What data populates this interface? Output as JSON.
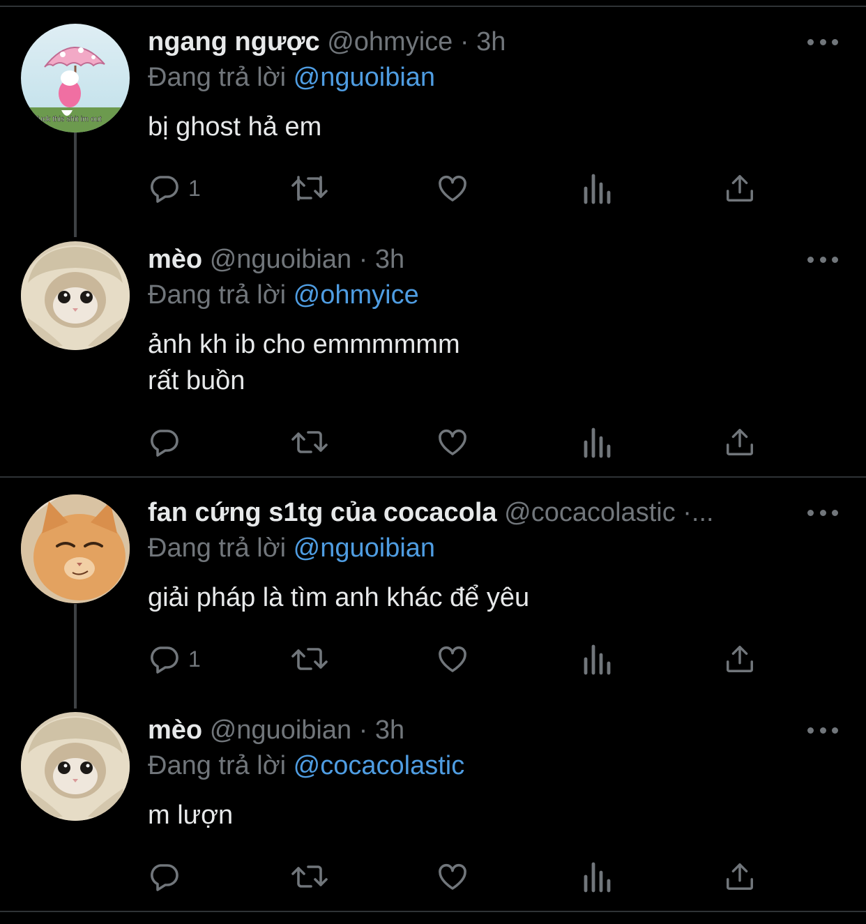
{
  "tweets": [
    {
      "name": "ngang ngược",
      "handle": "@ohmyice",
      "sep": "·",
      "time": "3h",
      "reply_label": "Đang trả lời",
      "reply_handle": "@nguoibian",
      "text": "bị ghost hả em",
      "reply_count": "1",
      "avatar_caption": "fuck this shit im out",
      "avatar": "pink-umbrella-character-avatar"
    },
    {
      "name": "mèo",
      "handle": "@nguoibian",
      "sep": "·",
      "time": "3h",
      "reply_label": "Đang trả lời",
      "reply_handle": "@ohmyice",
      "text": "ảnh kh ib cho emmmmmm\nrất buồn",
      "reply_count": "",
      "avatar": "cat-in-blanket-avatar"
    },
    {
      "name": "fan cứng s1tg của cocacola",
      "handle": "@cocacolastic",
      "sep": "·",
      "time": "...",
      "reply_label": "Đang trả lời",
      "reply_handle": "@nguoibian",
      "text": "giải pháp là tìm anh khác để yêu",
      "reply_count": "1",
      "avatar": "smirking-orange-cat-avatar"
    },
    {
      "name": "mèo",
      "handle": "@nguoibian",
      "sep": "·",
      "time": "3h",
      "reply_label": "Đang trả lời",
      "reply_handle": "@cocacolastic",
      "text": "m lượn",
      "reply_count": "",
      "avatar": "cat-in-blanket-avatar"
    }
  ],
  "icons": {
    "reply": "reply-icon",
    "retweet": "retweet-icon",
    "like": "heart-icon",
    "views": "analytics-icon",
    "share": "share-icon",
    "more": "more-icon"
  },
  "colors": {
    "background": "#000000",
    "text": "#e7e9ea",
    "secondary": "#71767b",
    "link": "#4f9de2",
    "divider": "#2f3336"
  }
}
